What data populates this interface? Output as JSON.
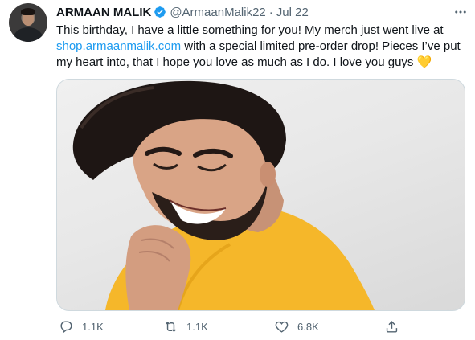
{
  "tweet": {
    "author_name": "ARMAAN MALIK",
    "handle": "@ArmaanMalik22",
    "separator": "·",
    "date": "Jul 22",
    "text_part1": "This birthday, I have a little something for you! My merch just went live at ",
    "link": "shop.armaanmalik.com",
    "text_part2": " with a special limited pre-order drop! Pieces I’ve put my heart into, that I hope you love as much as I do. I love you guys ",
    "emoji": "💛"
  },
  "actions": {
    "reply_count": "1.1K",
    "retweet_count": "1.1K",
    "like_count": "6.8K"
  },
  "colors": {
    "accent": "#1d9bf0",
    "secondary_text": "#536471",
    "shirt": "#f5b72a"
  },
  "icons": {
    "verified": "verified-badge-icon",
    "more": "more-options-icon",
    "reply": "reply-icon",
    "retweet": "retweet-icon",
    "like": "heart-icon",
    "share": "share-icon"
  }
}
